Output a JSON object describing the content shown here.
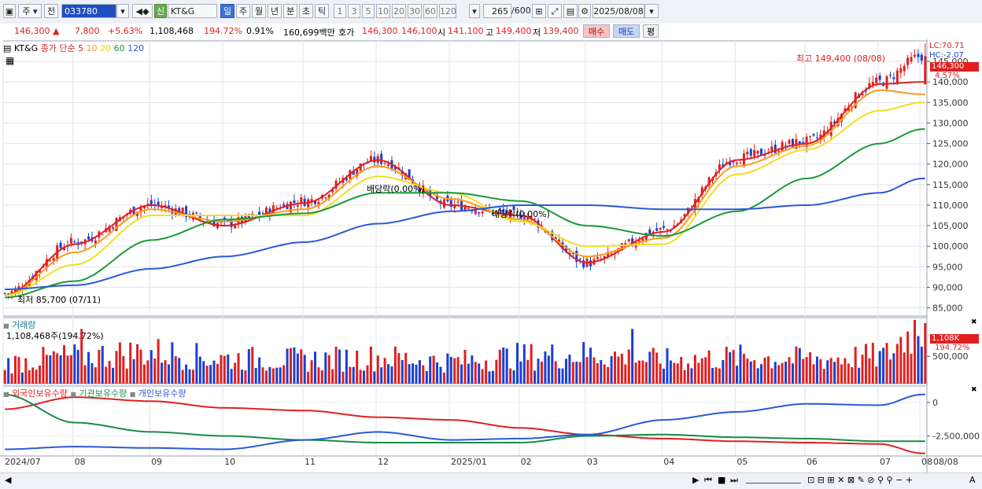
{
  "toolbar": {
    "period_day": "주",
    "front_label": "전",
    "code": "033780",
    "badge": "신",
    "name": "KT&G",
    "period_buttons": [
      "일",
      "주",
      "월",
      "년",
      "분",
      "초",
      "틱"
    ],
    "minute_buttons": [
      "1",
      "3",
      "5",
      "10",
      "20",
      "30",
      "60",
      "120"
    ],
    "count": "265",
    "count_total": "/600",
    "date": "2025/08/08"
  },
  "infobar": {
    "price": "146,300",
    "arrow": "▲",
    "change": "7,800",
    "change_pct": "+5.63%",
    "volume": "1,108,468",
    "volume_ratio": "194.72%",
    "turnover": "0.91%",
    "amount": "160,699백만",
    "quote_label": "호가",
    "ask": "146,300",
    "bid": "146,100",
    "open_label": "시",
    "open": "141,100",
    "high_label": "고",
    "high": "149,400",
    "low_label": "저",
    "low": "139,400",
    "buy": "매수",
    "sell": "매도",
    "eval": "평"
  },
  "price_panel": {
    "name": "KT&G",
    "ma_label": "종가 단순",
    "ma_periods": [
      "5",
      "10",
      "20",
      "60",
      "120"
    ],
    "ma_colors": [
      "#e02020",
      "#ff9a1a",
      "#f0e020",
      "#1a9a3a",
      "#2a5ad8"
    ],
    "lc": "LC:70.71",
    "hc": "HC:-2.07",
    "last_price": "146,300",
    "last_pct": "4.57%",
    "high_annotation": "최고 149,400 (08/08)",
    "low_annotation": "최저 85,700 (07/11)",
    "dividend_labels": [
      "배당락(0.00%)",
      "배당락(0.00%)"
    ],
    "y_ticks": [
      "145,000",
      "140,000",
      "135,000",
      "130,000",
      "125,000",
      "120,000",
      "115,000",
      "110,000",
      "105,000",
      "100,000",
      "95,000",
      "90,000",
      "85,000"
    ]
  },
  "volume_panel": {
    "title": "거래량",
    "value": "1,108,468주(194.72%)",
    "last": "1,108K",
    "last_pct": "194.72%",
    "y_ticks": [
      "500,000"
    ]
  },
  "investor_panel": {
    "legend": [
      "외국인보유수량",
      "기관보유수량",
      "개인보유수량"
    ],
    "colors": [
      "#e02020",
      "#1a8a4a",
      "#2a5ad8"
    ],
    "y_ticks": [
      "0",
      "-2,500,000"
    ]
  },
  "x_axis": {
    "labels": [
      "2024/07",
      "08",
      "09",
      "10",
      "11",
      "12",
      "2025/01",
      "02",
      "03",
      "04",
      "05",
      "06",
      "07",
      "08"
    ],
    "end_label": "08/08"
  },
  "chart_data": {
    "type": "candlestick",
    "title": "KT&G",
    "x": [
      "2024/07",
      "08",
      "09",
      "10",
      "11",
      "12",
      "2025/01",
      "02",
      "03",
      "04",
      "05",
      "06",
      "07",
      "08"
    ],
    "close": [
      88500,
      101000,
      110000,
      105500,
      111000,
      121000,
      110000,
      107500,
      96000,
      104000,
      121500,
      125500,
      140000,
      146300
    ],
    "high_price": 149400,
    "low_price": 85700,
    "ylim": [
      83000,
      150000
    ],
    "series": [
      {
        "name": "5",
        "values": [
          88000,
          100500,
          110000,
          105000,
          110500,
          121000,
          110000,
          107500,
          96000,
          103500,
          121000,
          125000,
          139500,
          140000
        ]
      },
      {
        "name": "10",
        "values": [
          88000,
          98500,
          109000,
          106000,
          109000,
          119500,
          111500,
          106500,
          97500,
          102000,
          119500,
          124500,
          138000,
          137000
        ]
      },
      {
        "name": "20",
        "values": [
          88000,
          95500,
          107500,
          107500,
          107500,
          117000,
          113000,
          106000,
          100000,
          100500,
          117500,
          123500,
          133000,
          135000
        ]
      },
      {
        "name": "60",
        "values": [
          87500,
          91500,
          101500,
          106500,
          108000,
          113000,
          113000,
          111000,
          105000,
          102500,
          108500,
          116500,
          125000,
          128500
        ]
      },
      {
        "name": "120",
        "values": [
          89500,
          90500,
          94500,
          97500,
          101000,
          105500,
          108500,
          110000,
          110000,
          109000,
          109000,
          110000,
          113000,
          116500
        ]
      }
    ],
    "volume": [
      400000,
      520000,
      600000,
      480000,
      460000,
      500000,
      430000,
      520000,
      560000,
      450000,
      500000,
      470000,
      520000,
      1108468
    ],
    "volume_ylim": [
      0,
      1150000
    ],
    "holdings": [
      {
        "name": "외국인보유수량",
        "values": [
          -500000,
          400000,
          100000,
          -400000,
          -600000,
          -1100000,
          -1300000,
          -1900000,
          -2400000,
          -2700000,
          -2900000,
          -3000000,
          -3100000,
          -3800000
        ]
      },
      {
        "name": "기관보유수량",
        "values": [
          600000,
          -1500000,
          -2200000,
          -2500000,
          -2800000,
          -3000000,
          -3000000,
          -3000000,
          -2500000,
          -2400000,
          -2600000,
          -2700000,
          -2900000,
          -2900000
        ]
      },
      {
        "name": "개인보유수량",
        "values": [
          -3500000,
          -3300000,
          -3400000,
          -3500000,
          -2800000,
          -2200000,
          -2800000,
          -2700000,
          -2400000,
          -1300000,
          -700000,
          -100000,
          -200000,
          600000
        ]
      }
    ],
    "holdings_ylim": [
      -4000000,
      1000000
    ]
  }
}
